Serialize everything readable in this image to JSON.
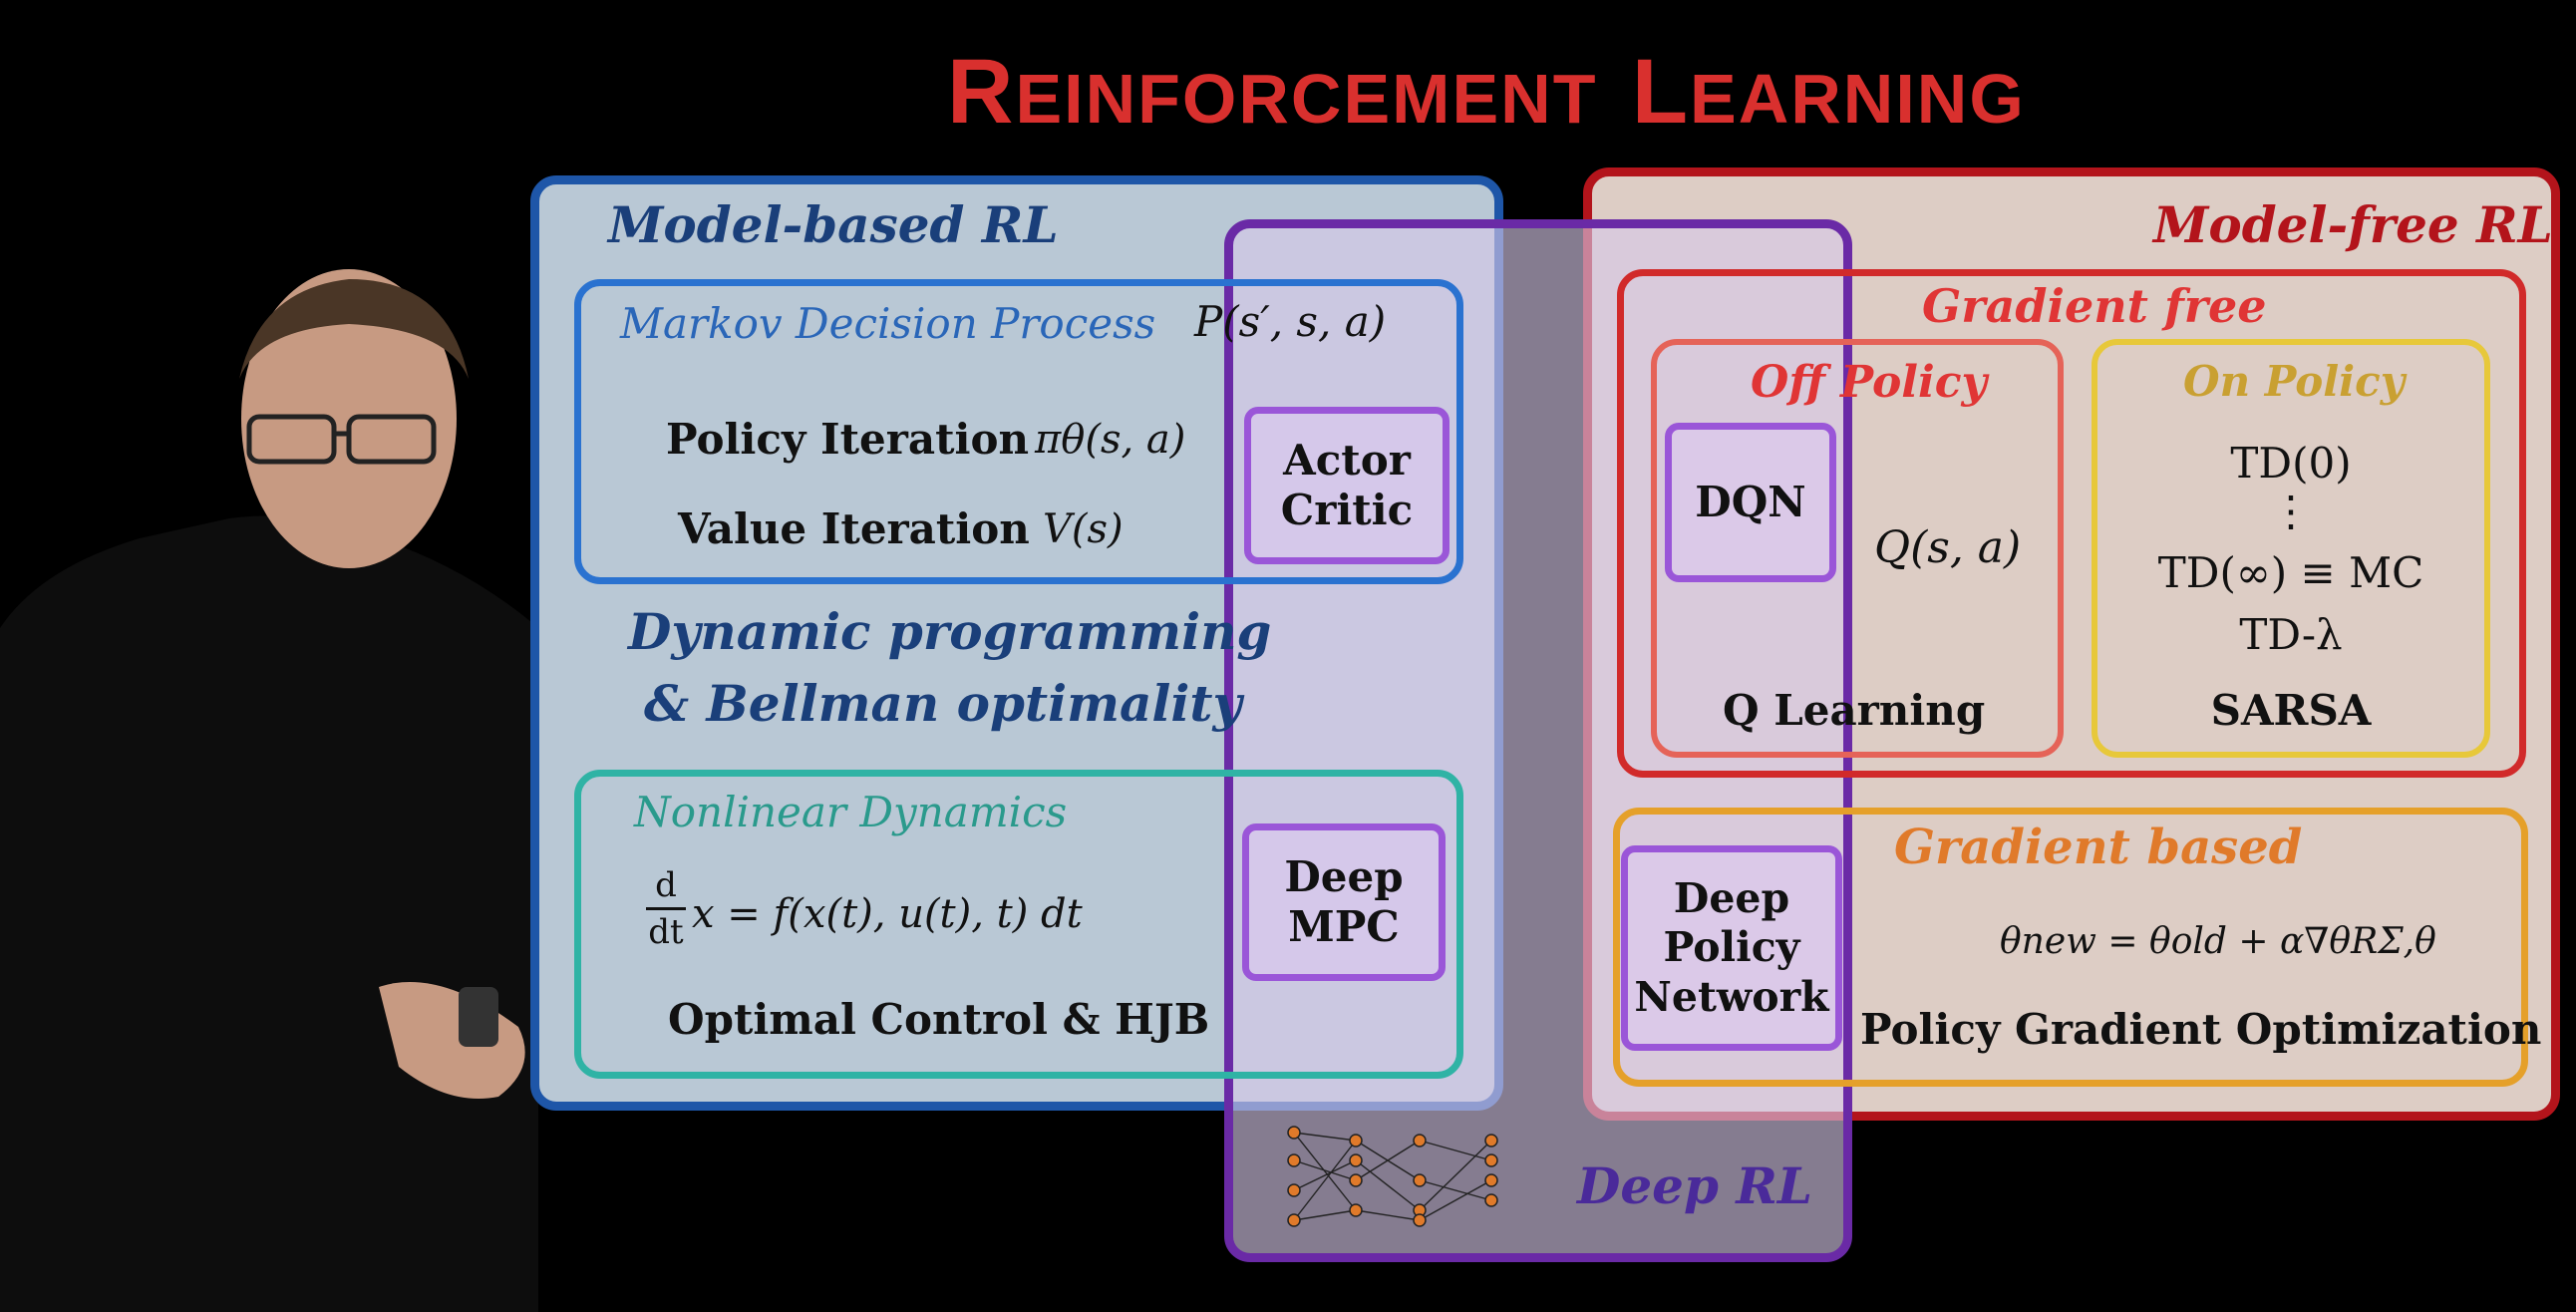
{
  "title": {
    "first_cap": "R",
    "first_rest": "EINFORCEMENT",
    "second_cap": "L",
    "second_rest": "EARNING"
  },
  "model_based": {
    "header": "Model-based RL",
    "mdp": {
      "header": "Markov Decision Process",
      "formula": "P(s′, s, a)"
    },
    "policy_iteration": {
      "label": "Policy Iteration",
      "formula": "πθ(s, a)"
    },
    "value_iteration": {
      "label": "Value Iteration",
      "formula": "V(s)"
    },
    "dp_line1": "Dynamic programming",
    "dp_line2": "& Bellman optimality",
    "nonlinear": {
      "header": "Nonlinear Dynamics",
      "formula": "x = f(x(t), u(t), t) dt",
      "deriv_top": "d",
      "deriv_bottom": "dt"
    },
    "optimal_control": "Optimal Control & HJB"
  },
  "overlap": {
    "actor_critic": "Actor\nCritic",
    "deep_mpc": "Deep\nMPC",
    "deep_rl": "Deep RL"
  },
  "model_free": {
    "header": "Model-free RL",
    "gradient_free": "Gradient free",
    "off_policy": {
      "header": "Off Policy",
      "dqn": "DQN",
      "q": "Q(s, a)",
      "footer": "Q Learning"
    },
    "on_policy": {
      "header": "On Policy",
      "lines": [
        "TD(0)",
        "⋮",
        "TD(∞) ≡ MC",
        "TD-λ"
      ],
      "footer": "SARSA"
    },
    "gradient_based": {
      "header": "Gradient based",
      "dpn": "Deep\nPolicy\nNetwork",
      "update": "θnew = θold + α∇θRΣ,θ",
      "footer": "Policy Gradient Optimization"
    }
  },
  "colors": {
    "title": "#d9302e",
    "model_based": "#1e56a8",
    "model_free": "#b3141b",
    "deep_rl": "#6a2aa6",
    "policy_box": "#9a56d8"
  }
}
